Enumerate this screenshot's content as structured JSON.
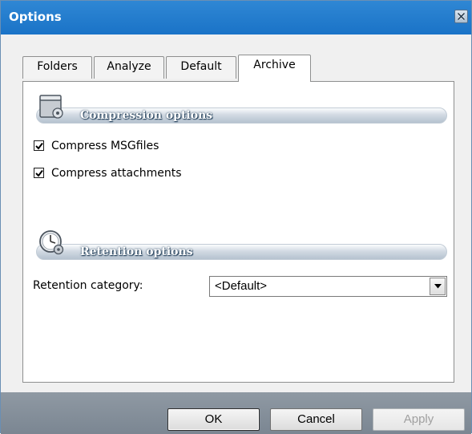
{
  "window": {
    "title": "Options"
  },
  "tabs": [
    {
      "label": "Folders",
      "active": false
    },
    {
      "label": "Analyze",
      "active": false
    },
    {
      "label": "Default",
      "active": false
    },
    {
      "label": "Archive",
      "active": true
    }
  ],
  "compression": {
    "section_label": "Compression options",
    "icon": "archive-box-icon",
    "options": [
      {
        "label": "Compress MSGfiles",
        "checked": true
      },
      {
        "label": "Compress attachments",
        "checked": true
      }
    ]
  },
  "retention": {
    "section_label": "Retention options",
    "icon": "clock-gear-icon",
    "category_label": "Retention category:",
    "category_value": "<Default>"
  },
  "footer": {
    "ok_label": "OK",
    "cancel_label": "Cancel",
    "apply_label": "Apply",
    "apply_enabled": false
  },
  "colors": {
    "titlebar": "#1a73c7",
    "footer": "#848e99"
  }
}
